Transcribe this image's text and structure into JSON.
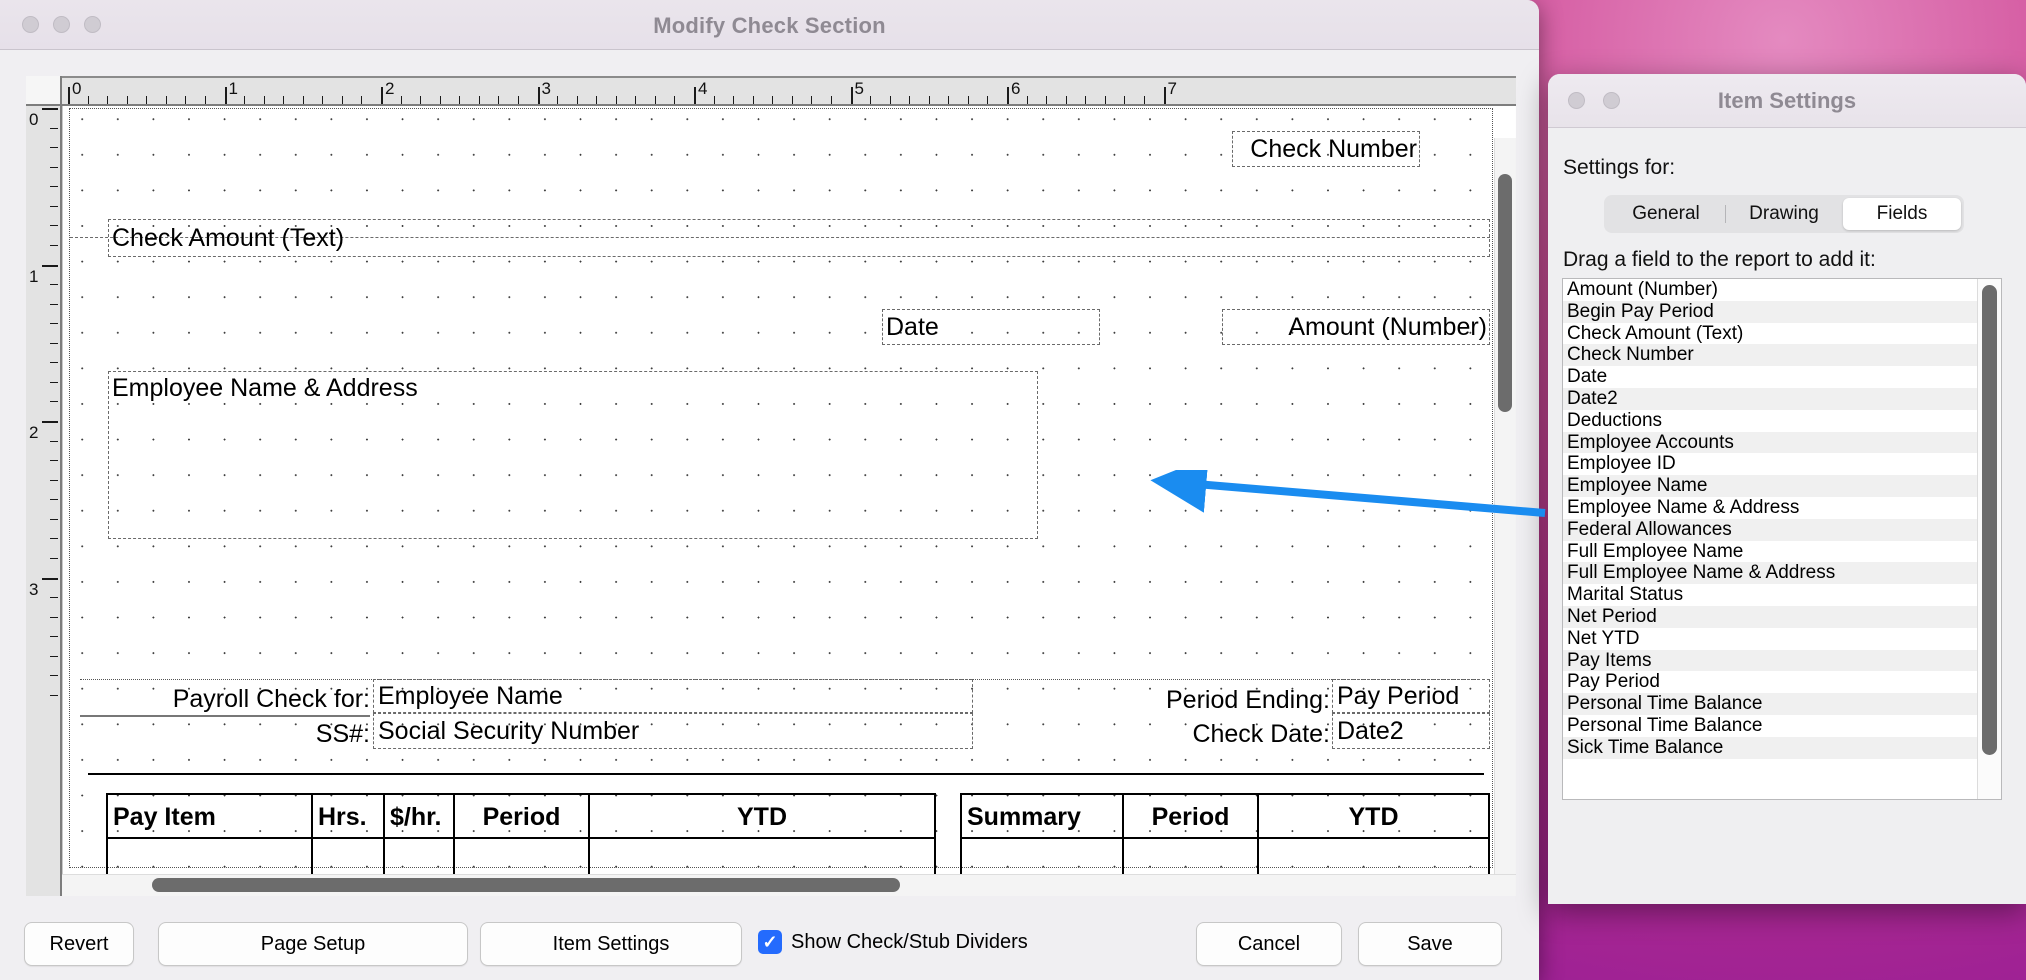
{
  "window": {
    "title": "Modify Check Section",
    "traffic_lights": [
      "close",
      "minimize",
      "zoom"
    ]
  },
  "ruler": {
    "horizontal_labels": [
      "0",
      "1",
      "2",
      "3",
      "4",
      "5",
      "6",
      "7"
    ],
    "vertical_labels": [
      "0",
      "1",
      "2",
      "3"
    ],
    "unit": "inches"
  },
  "canvas_fields": [
    {
      "id": "check-number",
      "label": "Check Number",
      "align": "right"
    },
    {
      "id": "check-amount-text",
      "label": "Check Amount (Text)",
      "align": "left"
    },
    {
      "id": "date",
      "label": "Date",
      "align": "left"
    },
    {
      "id": "amount-number",
      "label": "Amount (Number)",
      "align": "right"
    },
    {
      "id": "employee-name-address",
      "label": "Employee Name & Address",
      "align": "left"
    }
  ],
  "stub": {
    "payroll_check_for_label": "Payroll Check for:",
    "payroll_check_for_value": "Employee Name",
    "ss_label": "SS#:",
    "ss_value": "Social Security Number",
    "period_ending_label": "Period Ending:",
    "period_ending_value": "Pay Period",
    "check_date_label": "Check Date:",
    "check_date_value": "Date2",
    "table_left_headers": [
      "Pay Item",
      "Hrs.",
      "$/hr.",
      "Period",
      "YTD"
    ],
    "table_right_headers": [
      "Summary",
      "Period",
      "YTD"
    ]
  },
  "bottom_bar": {
    "revert": "Revert",
    "page_setup": "Page Setup",
    "item_settings": "Item Settings",
    "show_dividers_label": "Show Check/Stub Dividers",
    "show_dividers_checked": true,
    "checkmark_glyph": "✓",
    "cancel": "Cancel",
    "save": "Save",
    "accent_color": "#246bfd"
  },
  "item_settings": {
    "title": "Item Settings",
    "settings_for_label": "Settings for:",
    "tabs": [
      {
        "label": "General",
        "active": false
      },
      {
        "label": "Drawing",
        "active": false
      },
      {
        "label": "Fields",
        "active": true
      }
    ],
    "drag_hint": "Drag a field to the report to add it:",
    "fields": [
      "Amount (Number)",
      "Begin Pay Period",
      "Check Amount (Text)",
      "Check Number",
      "Date",
      "Date2",
      "Deductions",
      "Employee Accounts",
      "Employee ID",
      "Employee Name",
      "Employee Name & Address",
      "Federal Allowances",
      "Full Employee Name",
      "Full Employee Name & Address",
      "Marital Status",
      "Net Period",
      "Net YTD",
      "Pay Items",
      "Pay Period",
      "Personal Time Balance",
      "Personal Time Balance",
      "Sick Time Balance"
    ]
  },
  "annotation": {
    "arrow_color": "#1a8cf0",
    "points_from": "Employee ID",
    "points_to": "Employee Name & Address field on check"
  }
}
